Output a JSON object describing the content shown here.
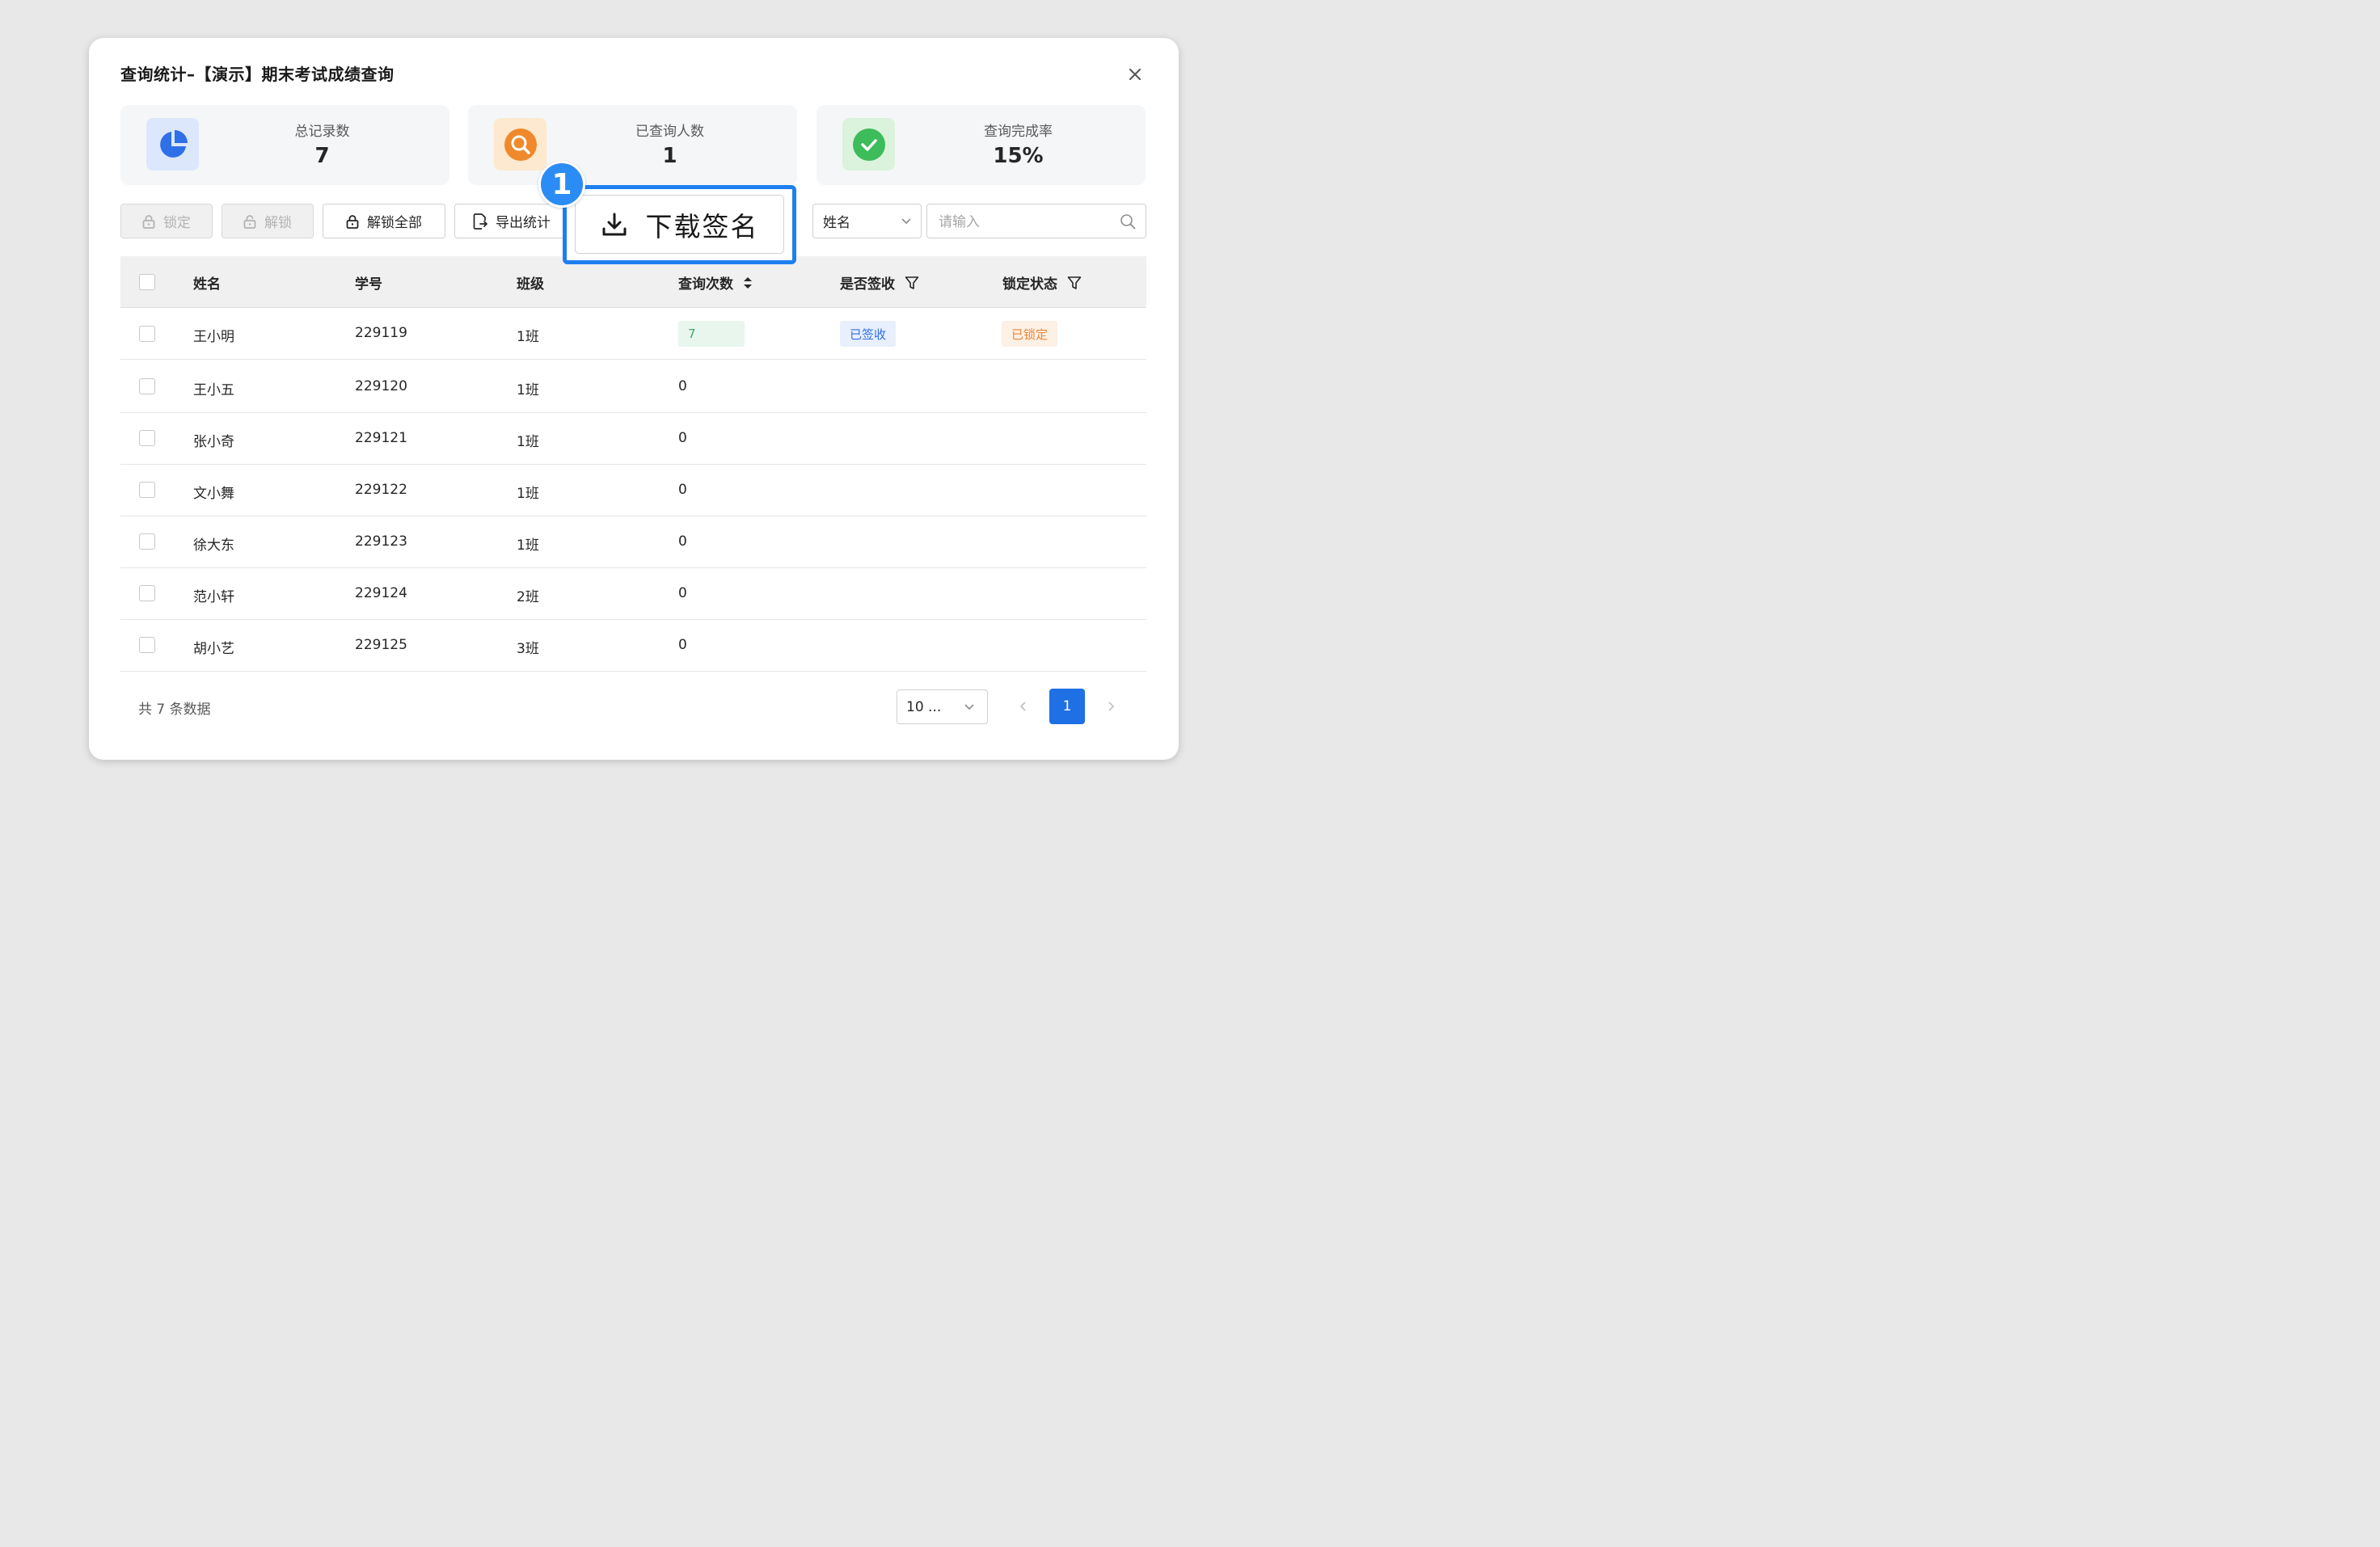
{
  "dialog": {
    "title": "查询统计–【演示】期末考试成绩查询",
    "close_icon": "close-icon"
  },
  "stats": [
    {
      "label": "总记录数",
      "value": "7",
      "icon": "pie-chart-icon",
      "icon_color": "#2f6fe8",
      "icon_bg": "#dde7fb"
    },
    {
      "label": "已查询人数",
      "value": "1",
      "icon": "search-icon",
      "icon_color": "#f0892b",
      "icon_bg": "#fde9cf"
    },
    {
      "label": "查询完成率",
      "value": "15%",
      "icon": "check-circle-icon",
      "icon_color": "#3cbc5a",
      "icon_bg": "#dbf2dd"
    }
  ],
  "toolbar": {
    "lock_label": "锁定",
    "unlock_label": "解锁",
    "unlock_all_label": "解锁全部",
    "export_label": "导出统计",
    "download_signature_label": "下载签名",
    "field_select_value": "姓名",
    "search_placeholder": "请输入"
  },
  "callout": {
    "number": "1",
    "color": "#1e7ff0"
  },
  "table": {
    "headers": {
      "name": "姓名",
      "student_id": "学号",
      "class": "班级",
      "query_count": "查询次数",
      "signed": "是否签收",
      "lock_status": "锁定状态"
    },
    "rows": [
      {
        "name": "王小明",
        "student_id": "229119",
        "class": "1班",
        "query_count": "7",
        "signed": "已签收",
        "lock_status": "已锁定"
      },
      {
        "name": "王小五",
        "student_id": "229120",
        "class": "1班",
        "query_count": "0",
        "signed": "",
        "lock_status": ""
      },
      {
        "name": "张小奇",
        "student_id": "229121",
        "class": "1班",
        "query_count": "0",
        "signed": "",
        "lock_status": ""
      },
      {
        "name": "文小舞",
        "student_id": "229122",
        "class": "1班",
        "query_count": "0",
        "signed": "",
        "lock_status": ""
      },
      {
        "name": "徐大东",
        "student_id": "229123",
        "class": "1班",
        "query_count": "0",
        "signed": "",
        "lock_status": ""
      },
      {
        "name": "范小轩",
        "student_id": "229124",
        "class": "2班",
        "query_count": "0",
        "signed": "",
        "lock_status": ""
      },
      {
        "name": "胡小艺",
        "student_id": "229125",
        "class": "3班",
        "query_count": "0",
        "signed": "",
        "lock_status": ""
      }
    ]
  },
  "pagination": {
    "total_text": "共 7 条数据",
    "page_size": "10 ...",
    "current_page": "1"
  },
  "colors": {
    "primary": "#1f6fe5",
    "tag_count_bg": "#e8f6ee",
    "tag_count_fg": "#3aa868",
    "tag_signed_bg": "#e8effd",
    "tag_signed_fg": "#2f6fe8",
    "tag_locked_bg": "#fdf0e4",
    "tag_locked_fg": "#e8863a"
  }
}
